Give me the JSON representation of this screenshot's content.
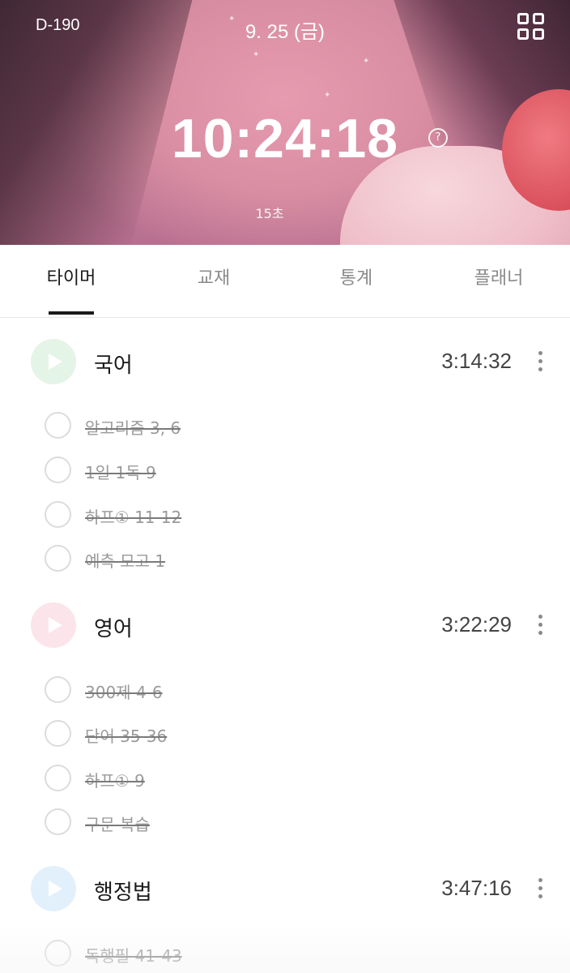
{
  "header": {
    "dday": "D-190",
    "date": "9. 25 (금)",
    "clock": "10:24:18",
    "sub_time": "15초",
    "menu_icon": "grid-icon",
    "help_icon": "question-circle-icon",
    "help_glyph": "?"
  },
  "tabs": [
    {
      "label": "타이머",
      "active": true
    },
    {
      "label": "교재",
      "active": false
    },
    {
      "label": "통계",
      "active": false
    },
    {
      "label": "플래너",
      "active": false
    }
  ],
  "subjects": [
    {
      "name": "국어",
      "time": "3:14:32",
      "color": "#e4f4e6",
      "tasks": [
        "알고리즘 3, 6",
        "1일 1독 9",
        "하프① 11-12",
        "예측 모고 1"
      ]
    },
    {
      "name": "영어",
      "time": "3:22:29",
      "color": "#fbe4ea",
      "tasks": [
        "300제 4-6",
        "단어 35-36",
        "하프① 9",
        "구문 복습"
      ]
    },
    {
      "name": "행정법",
      "time": "3:47:16",
      "color": "#e2f0fc",
      "tasks": [
        "독행필 41-43"
      ]
    }
  ],
  "colors": {
    "header_text": "#ffffff",
    "active_tab": "#1a1a1a",
    "inactive_tab": "#8a8a8a",
    "done_task": "#9a9a9a"
  }
}
